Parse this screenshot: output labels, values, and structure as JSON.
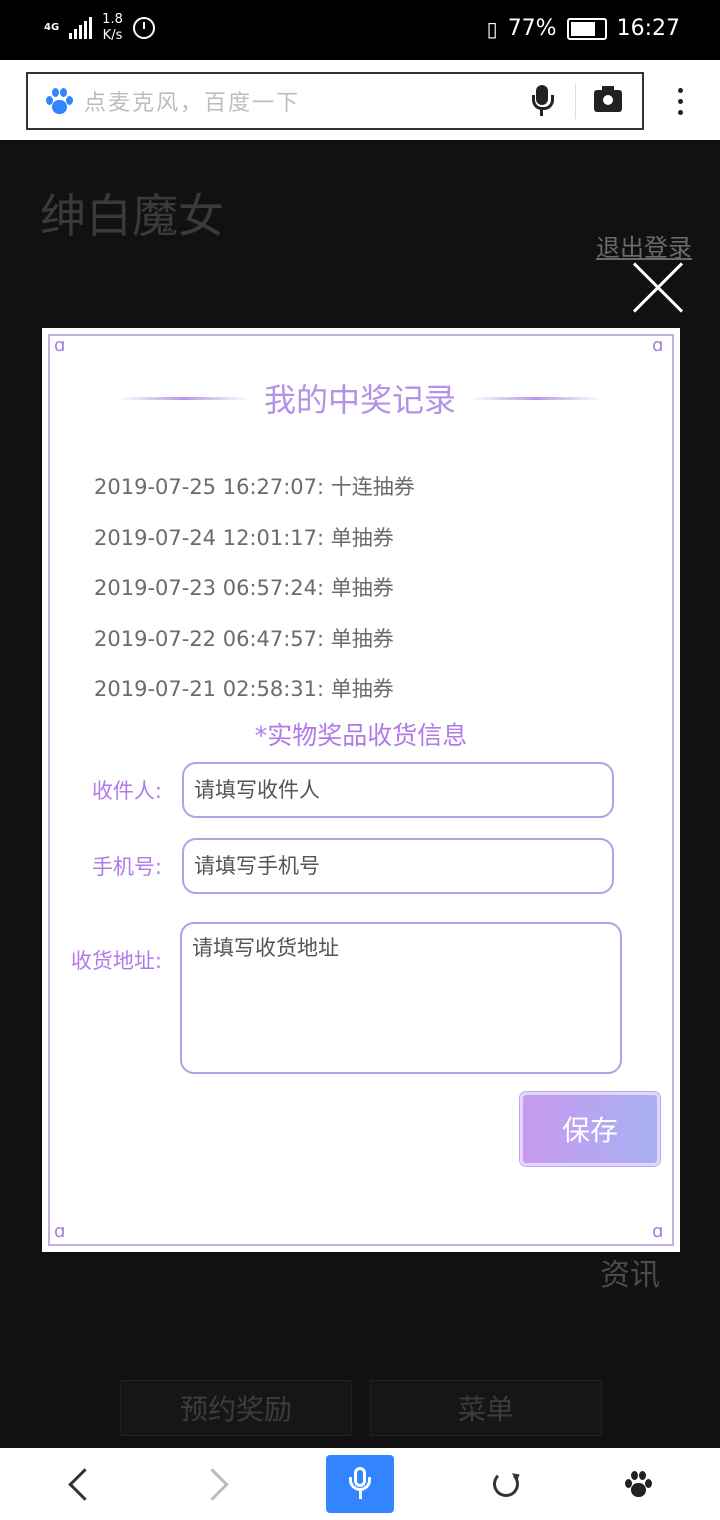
{
  "status_bar": {
    "network": "4G",
    "speed_value": "1.8",
    "speed_unit": "K/s",
    "battery": "77%",
    "time": "16:27"
  },
  "browser": {
    "search_placeholder": "点麦克风，百度一下"
  },
  "page": {
    "logo": "绅白魔女",
    "logout": "退出登录",
    "news": "资讯",
    "buttons": [
      "预约奖励",
      "菜单"
    ]
  },
  "modal": {
    "title": "我的中奖记录",
    "records": [
      "2019-07-25 16:27:07: 十连抽券",
      "2019-07-24 12:01:17: 单抽券",
      "2019-07-23 06:57:24: 单抽券",
      "2019-07-22 06:47:57: 单抽券",
      "2019-07-21 02:58:31: 单抽券"
    ],
    "section_title": "*实物奖品收货信息",
    "fields": {
      "recipient_label": "收件人:",
      "recipient_placeholder": "请填写收件人",
      "phone_label": "手机号:",
      "phone_placeholder": "请填写手机号",
      "address_label": "收货地址:",
      "address_placeholder": "请填写收货地址"
    },
    "save_label": "保存"
  },
  "colors": {
    "accent": "#b07be8",
    "input_border": "#b49ee6",
    "baidu_blue": "#3385ff"
  }
}
